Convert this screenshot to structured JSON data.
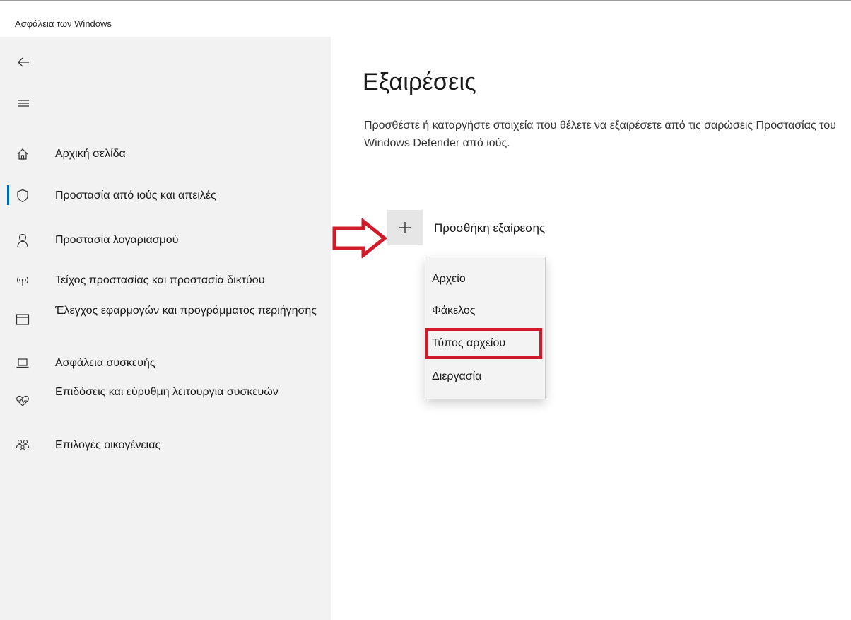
{
  "app": {
    "title": "Ασφάλεια των Windows"
  },
  "nav": {
    "back_icon": "back-arrow-icon",
    "menu_icon": "hamburger-icon",
    "items": [
      {
        "label": "Αρχική σελίδα",
        "icon": "home-icon"
      },
      {
        "label": "Προστασία από ιούς και απειλές",
        "icon": "shield-icon",
        "active": true
      },
      {
        "label": "Προστασία λογαριασμού",
        "icon": "person-icon"
      },
      {
        "label": "Τείχος προστασίας και προστασία δικτύου",
        "icon": "wireless-icon"
      },
      {
        "label": "Έλεγχος εφαρμογών και προγράμματος περιήγησης",
        "icon": "browser-window-icon"
      },
      {
        "label": "Ασφάλεια συσκευής",
        "icon": "laptop-icon"
      },
      {
        "label": "Επιδόσεις και εύρυθμη λειτουργία συσκευών",
        "icon": "heart-pulse-icon"
      },
      {
        "label": "Επιλογές οικογένειας",
        "icon": "family-icon"
      }
    ]
  },
  "main": {
    "title": "Εξαιρέσεις",
    "description": "Προσθέστε ή καταργήστε στοιχεία που θέλετε να εξαιρέσετε από τις σαρώσεις Προστασίας του Windows Defender από ιούς.",
    "add_exclusion_label": "Προσθήκη εξαίρεσης"
  },
  "menu": {
    "items": [
      "Αρχείο",
      "Φάκελος",
      "Τύπος αρχείου",
      "Διεργασία"
    ],
    "highlighted_index": 2
  },
  "colors": {
    "annotation_red": "#d01c2a",
    "accent_blue": "#0067c0",
    "sidebar_bg": "#f2f2f2"
  }
}
